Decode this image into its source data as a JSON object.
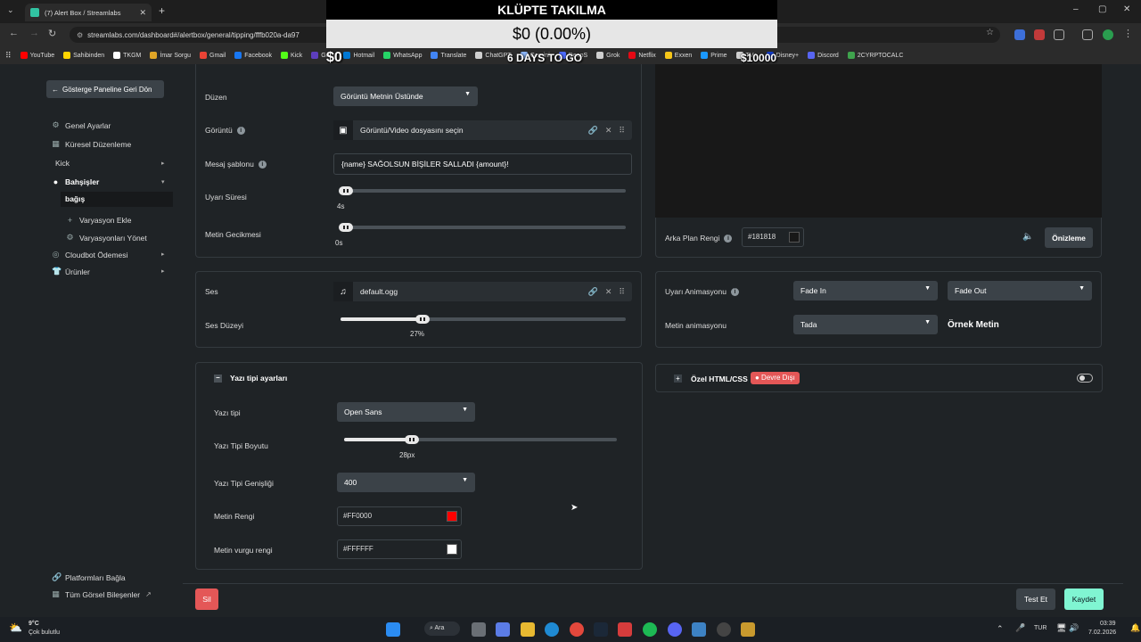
{
  "browser": {
    "tab_title": "(7) Alert Box / Streamlabs",
    "url": "streamlabs.com/dashboard#/alertbox/general/tipping/fffb020a-da97",
    "bookmarks": [
      "YouTube",
      "Sahibinden",
      "TKGM",
      "İmar Sorgu",
      "Gmail",
      "Facebook",
      "Kick",
      "Getir",
      "Hotmail",
      "WhatsApp",
      "Translate",
      "ChatGPT",
      "Gemini",
      "DeepS",
      "Grok",
      "Netflix",
      "Exxen",
      "Prime",
      "TV+",
      "Disney+",
      "Discord",
      "2CYRPTOCALC"
    ]
  },
  "overlay": {
    "title": "KLÜPTE TAKILMA",
    "progress_text": "$0 (0.00%)",
    "left_amount": "$0",
    "days_left": "6 DAYS TO GO",
    "goal_amount": "$10000"
  },
  "sidebar": {
    "back_label": "Gösterge Paneline Geri Dön",
    "items": [
      {
        "label": "Genel Ayarlar",
        "icon": "gear-icon"
      },
      {
        "label": "Küresel Düzenleme",
        "icon": "grid-icon"
      },
      {
        "label": "Kick",
        "icon": ""
      },
      {
        "label": "Bahşişler",
        "icon": "tip-icon"
      },
      {
        "label": "bağış",
        "icon": ""
      },
      {
        "label": "Varyasyon Ekle",
        "icon": "plus-icon"
      },
      {
        "label": "Varyasyonları Yönet",
        "icon": "gear-icon"
      },
      {
        "label": "Cloudbot Ödemesi",
        "icon": "cloudbot-icon"
      },
      {
        "label": "Ürünler",
        "icon": "shirt-icon"
      }
    ],
    "bottom": [
      {
        "label": "Platformları Bağla",
        "icon": "link-icon"
      },
      {
        "label": "Tüm Görsel Bileşenler",
        "icon": "grid-icon"
      }
    ]
  },
  "layout_card": {
    "layout_label": "Düzen",
    "layout_value": "Görüntü Metnin Üstünde",
    "image_label": "Görüntü",
    "image_value": "Görüntü/Video dosyasını seçin",
    "message_label": "Mesaj şablonu",
    "message_value": "{name} SAĞOLSUN BİŞİLER SALLADI {amount}!",
    "duration_label": "Uyarı Süresi",
    "duration_value": "4s",
    "duration_fraction": 0,
    "delay_label": "Metin Gecikmesi",
    "delay_value": "0s",
    "delay_fraction": 0
  },
  "sound_card": {
    "sound_label": "Ses",
    "sound_value": "default.ogg",
    "volume_label": "Ses Düzeyi",
    "volume_value": "27%",
    "volume_fraction": 0.27
  },
  "font_card": {
    "title": "Yazı tipi ayarları",
    "font_label": "Yazı tipi",
    "font_value": "Open Sans",
    "size_label": "Yazı Tipi Boyutu",
    "size_value": "28px",
    "size_fraction": 0.23,
    "weight_label": "Yazı Tipi Genişliği",
    "weight_value": "400",
    "text_color_label": "Metin Rengi",
    "text_color_value": "#FF0000",
    "text_color": "#FF0000",
    "highlight_label": "Metin vurgu rengi",
    "highlight_value": "#FFFFFF",
    "highlight_color": "#FFFFFF"
  },
  "preview": {
    "bg_label": "Arka Plan Rengi",
    "bg_value": "#181818",
    "preview_button": "Önizleme"
  },
  "animation_card": {
    "alert_anim_label": "Uyarı Animasyonu",
    "anim_in": "Fade In",
    "anim_out": "Fade Out",
    "text_anim_label": "Metin animasyonu",
    "text_anim_value": "Tada",
    "sample_text": "Örnek Metin"
  },
  "custom_card": {
    "title": "Özel HTML/CSS",
    "badge": "● Devre Dışı"
  },
  "footer": {
    "delete": "Sil",
    "test": "Test Et",
    "save": "Kaydet"
  },
  "taskbar": {
    "temp": "9°C",
    "weather": "Çok bulutlu",
    "search": "Ara",
    "lang": "TUR",
    "time": "03:39",
    "date": "7.02.2026"
  }
}
